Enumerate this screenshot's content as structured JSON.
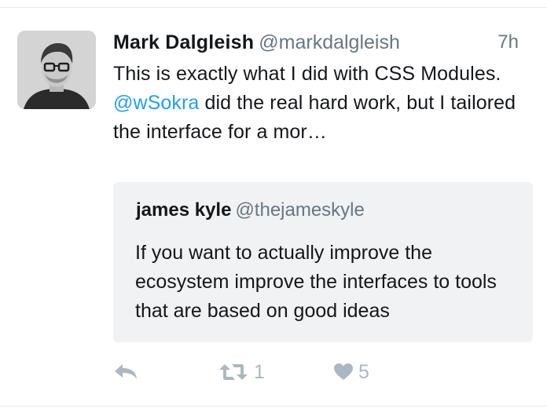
{
  "tweet": {
    "author_name": "Mark Dalgleish",
    "author_handle": "@markdalgleish",
    "timestamp": "7h",
    "text_before_mention": "This is exactly what I did with CSS Modules. ",
    "mention": "@wSokra",
    "text_after_mention": " did the real hard work, but I tailored the interface for a mor…",
    "avatar_icon": "user-avatar-photo"
  },
  "quote": {
    "author_name": "james kyle",
    "author_handle": "@thejameskyle",
    "text": "If you want to actually improve the ecosystem improve the interfaces to tools that are based on good ideas"
  },
  "actions": {
    "reply_icon": "reply-icon",
    "retweet_icon": "retweet-icon",
    "retweet_count": "1",
    "like_icon": "heart-icon",
    "like_count": "5"
  },
  "colors": {
    "link": "#1da1f2",
    "muted": "#657786",
    "icon": "#aab8c2",
    "quote_bg": "#f0f2f4"
  }
}
